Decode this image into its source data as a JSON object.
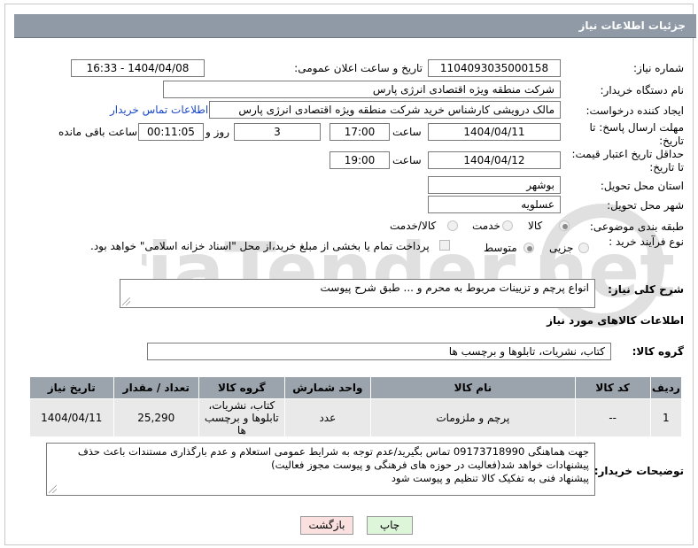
{
  "header": {
    "title": "جزئیات اطلاعات نیاز"
  },
  "fields": {
    "need_number": {
      "label": "شماره نیاز:",
      "value": "1104093035000158"
    },
    "announce_datetime": {
      "label": "تاریخ و ساعت اعلان عمومی:",
      "value": "1404/04/08 - 16:33"
    },
    "buyer_org": {
      "label": "نام دستگاه خریدار:",
      "value": "شرکت منطقه ویژه اقتصادی انرژی پارس"
    },
    "requester": {
      "label": "ایجاد کننده درخواست:",
      "value": "مالک  درویشی کارشناس خرید شرکت منطقه ویژه اقتصادی انرژی پارس",
      "link": "اطلاعات تماس خریدار"
    },
    "reply_deadline": {
      "label_line1": "مهلت ارسال پاسخ: تا",
      "label_line2": "تاریخ:",
      "date": "1404/04/11",
      "time_label": "ساعت",
      "time": "17:00",
      "days": "3",
      "days_label": "روز و",
      "remaining": "00:11:05",
      "remaining_label": "ساعت باقی مانده"
    },
    "price_validity": {
      "label_line1": "حداقل تاریخ اعتبار قیمت:",
      "label_line2": "تا تاریخ:",
      "date": "1404/04/12",
      "time_label": "ساعت",
      "time": "19:00"
    },
    "province": {
      "label": "استان محل تحویل:",
      "value": "بوشهر"
    },
    "city": {
      "label": "شهر محل تحویل:",
      "value": "عسلویه"
    },
    "category": {
      "label": "طبقه بندی موضوعی:",
      "options": [
        "کالا",
        "خدمت",
        "کالا/خدمت"
      ],
      "selected": "کالا"
    },
    "purchase_process": {
      "label": "نوع فرآیند خرید :",
      "options": [
        "جزیی",
        "متوسط"
      ],
      "selected": "متوسط",
      "checkbox_text": "پرداخت تمام یا بخشی از مبلغ خرید،از محل \"اسناد خزانه اسلامی\" خواهد بود."
    }
  },
  "description": {
    "label": "شرح کلی نیاز:",
    "value": "انواع پرچم و تزیینات مربوط به محرم و ... طبق شرح پیوست"
  },
  "goods_section": {
    "title": "اطلاعات کالاهای مورد نیاز",
    "group_label": "گروه کالا:",
    "group_value": "کتاب، نشریات، تابلوها و برچسب ها"
  },
  "table": {
    "headers": [
      "ردیف",
      "کد کالا",
      "نام کالا",
      "واحد شمارش",
      "گروه کالا",
      "تعداد / مقدار",
      "تاریخ نیاز"
    ],
    "rows": [
      [
        "1",
        "--",
        "پرچم و ملزومات",
        "عدد",
        "کتاب، نشریات، تابلوها و برچسب ها",
        "25,290",
        "1404/04/11"
      ]
    ]
  },
  "buyer_notes": {
    "label": "توضیحات خریدار:",
    "lines": [
      "جهت هماهنگی 09173718990 تماس بگیرید/عدم توجه به شرایط عمومی استعلام و عدم بارگذاری مستندات باعث حذف",
      "پیشنهادات خواهد شد(فعالیت در حوزه های فرهنگی و پیوست مجوز فعالیت)",
      "پیشنهاد فنی به تفکیک کالا تنظیم و پیوست شود"
    ]
  },
  "buttons": {
    "print": "چاپ",
    "back": "بازگشت"
  },
  "watermark": {
    "text": "AriaTender.net"
  },
  "colors": {
    "header_bg": "#8f9aa6",
    "table_header_bg": "#9ba4ad",
    "row_bg": "#e9e9e9",
    "link": "#1a47c9",
    "print_btn": "#ddf5d9",
    "back_btn": "#fbe0e0"
  }
}
